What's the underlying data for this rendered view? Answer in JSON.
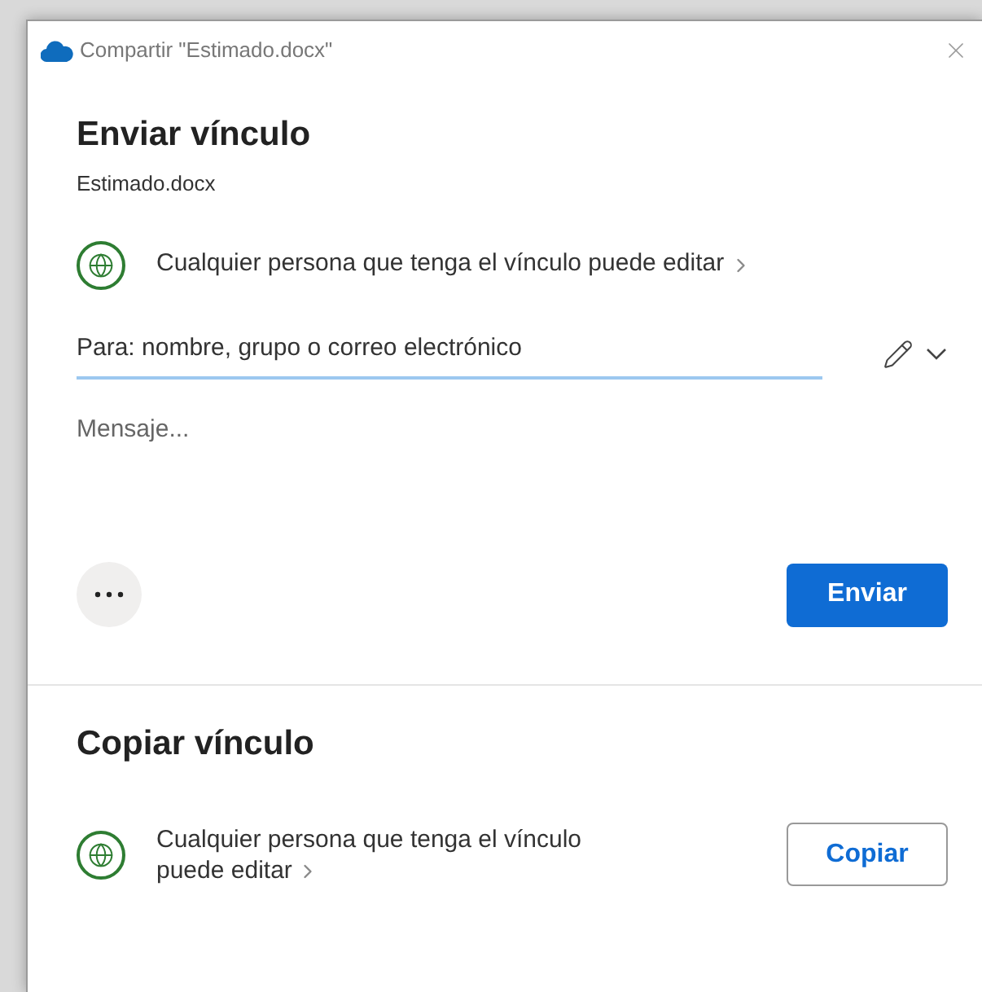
{
  "window": {
    "title": "Compartir \"Estimado.docx\""
  },
  "send_link": {
    "heading": "Enviar vínculo",
    "file_name": "Estimado.docx",
    "permission": "Cualquier persona que tenga el vínculo puede editar",
    "to_field": {
      "placeholder": "Para: nombre, grupo o correo electrónico"
    },
    "message_field": {
      "placeholder": "Mensaje..."
    },
    "send_button": "Enviar"
  },
  "copy_link": {
    "heading": "Copiar vínculo",
    "permission": "Cualquier persona que tenga el vínculo puede editar",
    "copy_button": "Copiar"
  }
}
